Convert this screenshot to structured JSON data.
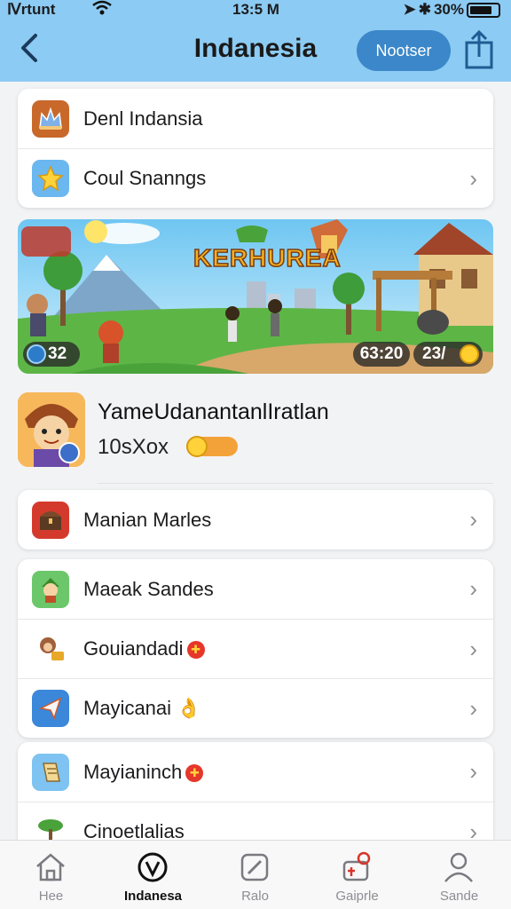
{
  "status": {
    "carrier": "Ⅳrtunt",
    "time": "13:5 M",
    "battery": "30%"
  },
  "nav": {
    "back_label": "‹",
    "title": "Indanesia",
    "pill_label": "Nootser"
  },
  "top_card": [
    {
      "label": "Denl Indansia",
      "icon": "crown-icon"
    },
    {
      "label": "Coul Snanngs",
      "icon": "star-icon"
    }
  ],
  "banner": {
    "title": "KERHUREA",
    "left_counter": "32",
    "time": "63:20",
    "score": "23/"
  },
  "profile": {
    "name": "YameUdanantanlIratlan",
    "sub": "10sXox",
    "progress": 0.35
  },
  "card_one": [
    {
      "label": "Manian Marles",
      "icon": "chest-icon"
    }
  ],
  "card_two": [
    {
      "label": "Maeak Sandes",
      "icon": "elf-icon"
    },
    {
      "label": "Gouiandadi",
      "icon": "monkey-icon",
      "badge": "✚"
    },
    {
      "label": "Mayicanai",
      "icon": "paper-plane-icon",
      "emoji": "👌"
    }
  ],
  "card_three": [
    {
      "label": "Mayianinch",
      "icon": "scroll-icon",
      "badge": "✚"
    },
    {
      "label": "Cinoetlalias",
      "icon": "tree-icon"
    }
  ],
  "tabs": [
    {
      "label": "Hee",
      "icon": "home-icon"
    },
    {
      "label": "Indanesa",
      "icon": "compass-icon",
      "active": true
    },
    {
      "label": "Ralo",
      "icon": "edit-icon"
    },
    {
      "label": "Gaiprle",
      "icon": "game-icon"
    },
    {
      "label": "Sande",
      "icon": "profile-icon"
    }
  ],
  "colors": {
    "header": "#8ccbf3",
    "accent": "#3b87c9",
    "background": "#f2f3f5"
  }
}
